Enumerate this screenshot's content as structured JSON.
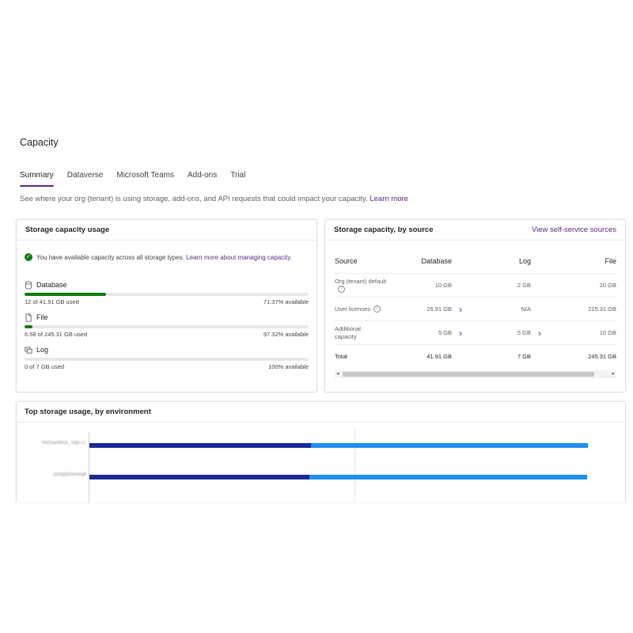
{
  "page": {
    "title": "Capacity"
  },
  "tabs": [
    {
      "label": "Summary",
      "selected": true
    },
    {
      "label": "Dataverse",
      "selected": false
    },
    {
      "label": "Microsoft Teams",
      "selected": false
    },
    {
      "label": "Add-ons",
      "selected": false
    },
    {
      "label": "Trial",
      "selected": false
    }
  ],
  "description": {
    "text": "See where your org (tenant) is using storage, add-ons, and API requests that could impact your capacity.",
    "link": "Learn more"
  },
  "usage_card": {
    "title": "Storage capacity usage",
    "status_text": "You have available capacity across all storage types.",
    "status_link": "Learn more about managing capacity.",
    "meters": [
      {
        "name": "Database",
        "icon": "database-icon",
        "used_text": "12 of 41.91 GB used",
        "available_text": "71.37% available",
        "used_fraction": 0.2863
      },
      {
        "name": "File",
        "icon": "file-icon",
        "used_text": "6.58 of 245.31 GB used",
        "available_text": "97.32% available",
        "used_fraction": 0.0268
      },
      {
        "name": "Log",
        "icon": "log-icon",
        "used_text": "0 of 7 GB used",
        "available_text": "100% available",
        "used_fraction": 0
      }
    ],
    "bar_color": "#107c10"
  },
  "source_card": {
    "title": "Storage capacity, by source",
    "link": "View self-service sources",
    "columns": [
      "Source",
      "Database",
      "Log",
      "File"
    ],
    "rows": [
      {
        "source": "Org (tenant) default",
        "info": true,
        "database": "10 GB",
        "log": "2 GB",
        "file": "20 GB",
        "db_chevron": false,
        "log_chevron": false
      },
      {
        "source": "User licenses",
        "info": true,
        "database": "26.91 GB",
        "log": "N/A",
        "file": "215.31 GB",
        "db_chevron": true,
        "log_chevron": false
      },
      {
        "source": "Additional capacity",
        "info": false,
        "database": "5 GB",
        "log": "5 GB",
        "file": "10 GB",
        "db_chevron": true,
        "log_chevron": true
      }
    ],
    "total": {
      "source": "Total",
      "database": "41.91 GB",
      "log": "7 GB",
      "file": "245.31 GB"
    }
  },
  "env_card": {
    "title": "Top storage usage, by environment",
    "environments": [
      {
        "name": "TestSandbox_Sep-17",
        "dark_value": 0.445,
        "light_value": 0.555
      },
      {
        "name": "perappnerningll",
        "dark_value": 0.442,
        "light_value": 0.556
      }
    ],
    "colors": {
      "dark": "#1b2a96",
      "light": "#1e8fef"
    }
  },
  "accent_color": "#5b2b82"
}
